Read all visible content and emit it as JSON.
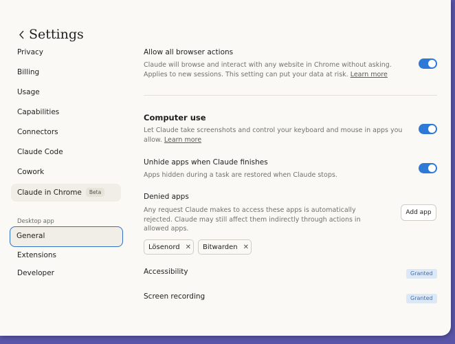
{
  "header": {
    "title": "Settings"
  },
  "sidebar": {
    "items": [
      {
        "label": "Privacy"
      },
      {
        "label": "Billing"
      },
      {
        "label": "Usage"
      },
      {
        "label": "Capabilities"
      },
      {
        "label": "Connectors"
      },
      {
        "label": "Claude Code"
      },
      {
        "label": "Cowork"
      },
      {
        "label": "Claude in Chrome",
        "badge": "Beta"
      }
    ],
    "section_label": "Desktop app",
    "desktop_items": [
      {
        "label": "General",
        "active": true
      },
      {
        "label": "Extensions"
      },
      {
        "label": "Developer"
      }
    ]
  },
  "main": {
    "browser_actions": {
      "label": "Allow all browser actions",
      "desc": "Claude will browse and interact with any website in Chrome without asking. Applies to new sessions. This setting can put your data at risk.",
      "link": "Learn more",
      "enabled": true
    },
    "computer_use": {
      "label": "Computer use",
      "desc": "Let Claude take screenshots and control your keyboard and mouse in apps you allow.",
      "link": "Learn more",
      "enabled": true
    },
    "unhide_apps": {
      "label": "Unhide apps when Claude finishes",
      "desc": "Apps hidden during a task are restored when Claude stops.",
      "enabled": true
    },
    "denied_apps": {
      "label": "Denied apps",
      "desc": "Any request Claude makes to access these apps is automatically rejected. Claude may still affect them indirectly through actions in allowed apps.",
      "add_button": "Add app",
      "apps": [
        "Lösenord",
        "Bitwarden"
      ]
    },
    "accessibility": {
      "label": "Accessibility",
      "status": "Granted"
    },
    "screen_recording": {
      "label": "Screen recording",
      "status": "Granted"
    }
  },
  "colors": {
    "accent": "#2f79d6",
    "background": "#faf9f5",
    "desktop": "#5a55a8"
  }
}
